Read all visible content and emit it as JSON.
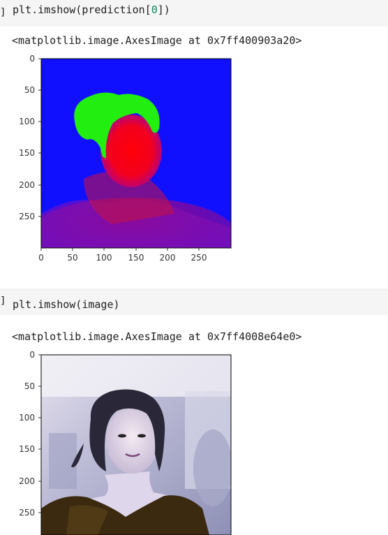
{
  "cells": [
    {
      "prompt": "]",
      "code": {
        "prefix": "plt.imshow(prediction[",
        "number": "0",
        "suffix": "])"
      },
      "output_text": "<matplotlib.image.AxesImage at 0x7ff400903a20>",
      "plot": {
        "image": "segmentation-mask-green-hair-red-skin-blue-background",
        "y_ticks": [
          "0",
          "50",
          "100",
          "150",
          "200",
          "250"
        ],
        "x_ticks": [
          "0",
          "50",
          "100",
          "150",
          "200",
          "250"
        ]
      }
    },
    {
      "prompt": "]",
      "code": {
        "prefix": "plt.imshow(image)",
        "number": "",
        "suffix": ""
      },
      "output_text": "<matplotlib.image.AxesImage at 0x7ff4008e64e0>",
      "plot": {
        "image": "portrait-photo-woman-bluish-tint",
        "y_ticks": [
          "0",
          "50",
          "100",
          "150",
          "200",
          "250"
        ]
      }
    }
  ],
  "colors": {
    "cell_bg": "#f5f5f5",
    "number_green": "#09885a",
    "mask_background": "#1010ff",
    "mask_face": "#ff0010",
    "mask_hair": "#22ee10"
  }
}
